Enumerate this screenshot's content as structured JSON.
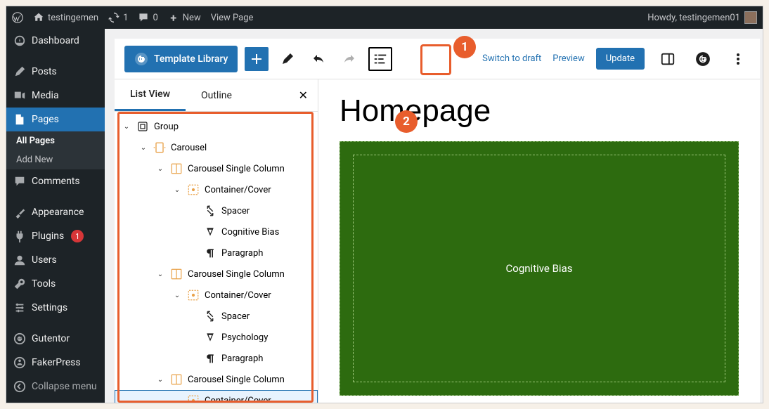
{
  "adminbar": {
    "site_name": "testingemen",
    "updates_count": "1",
    "comments_count": "0",
    "new_label": "New",
    "view_page": "View Page",
    "howdy": "Howdy, testingemen01"
  },
  "sidebar": {
    "items": [
      {
        "label": "Dashboard"
      },
      {
        "label": "Posts"
      },
      {
        "label": "Media"
      },
      {
        "label": "Pages"
      },
      {
        "label": "Comments"
      },
      {
        "label": "Appearance"
      },
      {
        "label": "Plugins"
      },
      {
        "label": "Users"
      },
      {
        "label": "Tools"
      },
      {
        "label": "Settings"
      },
      {
        "label": "Gutentor"
      },
      {
        "label": "FakerPress"
      },
      {
        "label": "Collapse menu"
      }
    ],
    "pages_submenu": {
      "all_pages": "All Pages",
      "add_new": "Add New"
    },
    "plugins_badge": "1"
  },
  "toolbar": {
    "template_library": "Template Library",
    "switch_to_draft": "Switch to draft",
    "preview": "Preview",
    "update": "Update"
  },
  "listview": {
    "tab_listview": "List View",
    "tab_outline": "Outline",
    "tree": [
      {
        "indent": 0,
        "chev": true,
        "icon": "group",
        "label": "Group"
      },
      {
        "indent": 1,
        "chev": true,
        "icon": "carousel",
        "label": "Carousel"
      },
      {
        "indent": 2,
        "chev": true,
        "icon": "column",
        "label": "Carousel Single Column"
      },
      {
        "indent": 3,
        "chev": true,
        "icon": "container",
        "label": "Container/Cover"
      },
      {
        "indent": 4,
        "chev": false,
        "icon": "spacer",
        "label": "Spacer"
      },
      {
        "indent": 4,
        "chev": false,
        "icon": "heading",
        "label": "Cognitive Bias"
      },
      {
        "indent": 4,
        "chev": false,
        "icon": "paragraph",
        "label": "Paragraph"
      },
      {
        "indent": 2,
        "chev": true,
        "icon": "column",
        "label": "Carousel Single Column"
      },
      {
        "indent": 3,
        "chev": true,
        "icon": "container",
        "label": "Container/Cover"
      },
      {
        "indent": 4,
        "chev": false,
        "icon": "spacer",
        "label": "Spacer"
      },
      {
        "indent": 4,
        "chev": false,
        "icon": "heading",
        "label": "Psychology"
      },
      {
        "indent": 4,
        "chev": false,
        "icon": "paragraph",
        "label": "Paragraph"
      },
      {
        "indent": 2,
        "chev": true,
        "icon": "column",
        "label": "Carousel Single Column"
      },
      {
        "indent": 3,
        "chev": true,
        "icon": "container",
        "label": "Container/Cover",
        "selected": true
      }
    ]
  },
  "canvas": {
    "title": "Homepage",
    "cover_text": "Cognitive Bias"
  },
  "callouts": {
    "c1": "1",
    "c2": "2"
  }
}
